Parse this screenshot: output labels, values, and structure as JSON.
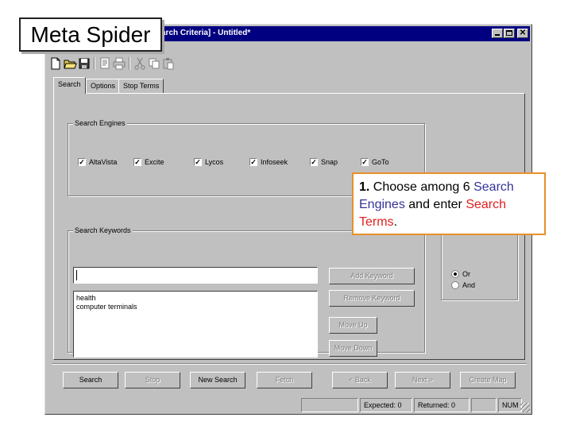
{
  "overlay": {
    "label": "Meta Spider",
    "callout": {
      "number": "1.",
      "part1": " Choose among 6 ",
      "term1": "Search Engines",
      "part2": " and enter ",
      "term2": "Search Terms",
      "part3": "."
    }
  },
  "window": {
    "title": "arch Criteria] - Untitled*",
    "controls": {
      "minimize": "minimize-icon",
      "maximize": "maximize-icon",
      "close": "✕"
    }
  },
  "toolbar": {
    "icons": [
      "new-file-icon",
      "open-folder-icon",
      "save-icon",
      "print-preview-icon",
      "print-icon",
      "cut-icon",
      "copy-icon",
      "paste-icon"
    ]
  },
  "tabs": [
    {
      "label": "Search",
      "active": true
    },
    {
      "label": "Options",
      "active": false
    },
    {
      "label": "Stop Terms",
      "active": false
    }
  ],
  "search_engines": {
    "label": "Search Engines",
    "items": [
      {
        "label": "AltaVista",
        "checked": true
      },
      {
        "label": "Excite",
        "checked": true
      },
      {
        "label": "Lycos",
        "checked": true
      },
      {
        "label": "Infoseek",
        "checked": true
      },
      {
        "label": "Snap",
        "checked": true
      },
      {
        "label": "GoTo",
        "checked": true
      }
    ]
  },
  "keywords": {
    "label": "Search Keywords",
    "input_value": "",
    "list": [
      "health",
      "computer terminals"
    ],
    "add_button": "Add Keyword",
    "remove_button": "Remove Keyword",
    "move_up_button": "Move Up",
    "move_down_button": "Move Down"
  },
  "logic": {
    "options": [
      {
        "label": "Or",
        "selected": true
      },
      {
        "label": "And",
        "selected": false
      }
    ]
  },
  "actions": {
    "search": "Search",
    "stop": "Stop",
    "new_search": "New Search",
    "fetch": "Fetch",
    "back": "< Back",
    "next": "Next >",
    "create_map": "Create Map"
  },
  "status": {
    "expected": "Expected: 0",
    "returned": "Returned: 0",
    "num": "NUM"
  },
  "colors": {
    "titlebar": "#000080",
    "face": "#c0c0c0",
    "callout_border": "#e8902a",
    "callout_blue": "#333399",
    "callout_red": "#e02020"
  }
}
